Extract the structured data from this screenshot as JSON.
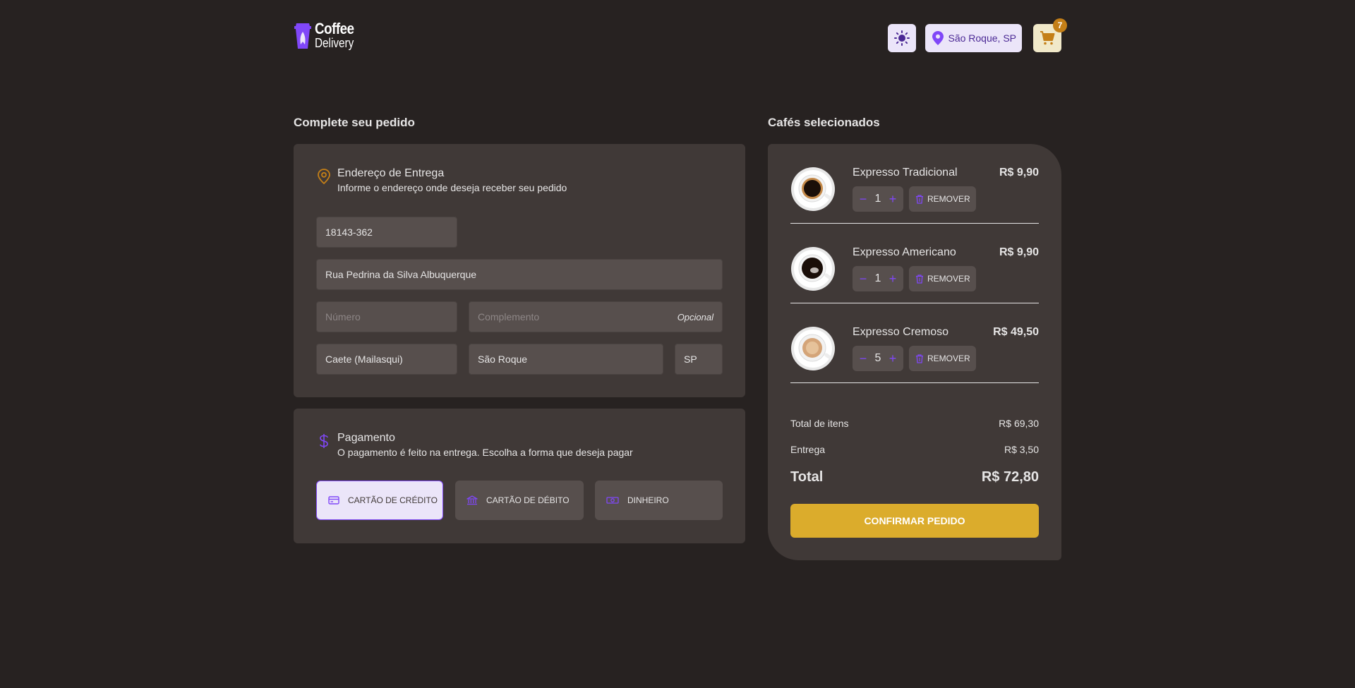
{
  "brand": {
    "line1": "Coffee",
    "line2": "Delivery",
    "accent": "#8047F8"
  },
  "header": {
    "theme_icon": "sun-icon",
    "location": "São Roque, SP",
    "cart_count": "7"
  },
  "checkout": {
    "title": "Complete seu pedido",
    "address": {
      "title": "Endereço de Entrega",
      "subtitle": "Informe o endereço onde deseja receber seu pedido",
      "cep": "18143-362",
      "street": "Rua Pedrina da Silva Albuquerque",
      "number_placeholder": "Número",
      "complement_placeholder": "Complemento",
      "optional_label": "Opcional",
      "neighborhood": "Caete (Mailasqui)",
      "city": "São Roque",
      "uf": "SP"
    },
    "payment": {
      "title": "Pagamento",
      "subtitle": "O pagamento é feito na entrega. Escolha a forma que deseja pagar",
      "options": [
        {
          "label": "Cartão de crédito",
          "icon": "credit-card-icon",
          "selected": true
        },
        {
          "label": "Cartão de débito",
          "icon": "bank-icon",
          "selected": false
        },
        {
          "label": "Dinheiro",
          "icon": "money-icon",
          "selected": false
        }
      ]
    }
  },
  "cart": {
    "title": "Cafés selecionados",
    "items": [
      {
        "name": "Expresso Tradicional",
        "price": "R$ 9,90",
        "qty": "1",
        "remove": "REMOVER"
      },
      {
        "name": "Expresso Americano",
        "price": "R$ 9,90",
        "qty": "1",
        "remove": "REMOVER"
      },
      {
        "name": "Expresso Cremoso",
        "price": "R$ 49,50",
        "qty": "5",
        "remove": "REMOVER"
      }
    ],
    "summary": {
      "items_label": "Total de itens",
      "items_value": "R$ 69,30",
      "delivery_label": "Entrega",
      "delivery_value": "R$ 3,50",
      "total_label": "Total",
      "total_value": "R$ 72,80"
    },
    "confirm_label": "Confirmar pedido"
  }
}
